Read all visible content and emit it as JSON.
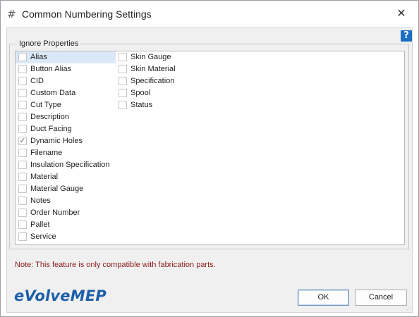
{
  "window": {
    "icon": "hash-icon",
    "icon_glyph": "#",
    "title": "Common Numbering Settings",
    "close_glyph": "✕"
  },
  "help": {
    "glyph": "?",
    "color": "#1c6fc0"
  },
  "ignore_properties": {
    "caption": "Ignore Properties",
    "column1": [
      {
        "label": "Alias",
        "checked": false,
        "selected": true
      },
      {
        "label": "Button Alias",
        "checked": false
      },
      {
        "label": "CID",
        "checked": false
      },
      {
        "label": "Custom Data",
        "checked": false
      },
      {
        "label": "Cut Type",
        "checked": false
      },
      {
        "label": "Description",
        "checked": false
      },
      {
        "label": "Duct Facing",
        "checked": false
      },
      {
        "label": "Dynamic Holes",
        "checked": true
      },
      {
        "label": "Filename",
        "checked": false
      },
      {
        "label": "Insulation Specification",
        "checked": false
      },
      {
        "label": "Material",
        "checked": false
      },
      {
        "label": "Material Gauge",
        "checked": false
      },
      {
        "label": "Notes",
        "checked": false
      },
      {
        "label": "Order Number",
        "checked": false
      },
      {
        "label": "Pallet",
        "checked": false
      },
      {
        "label": "Service",
        "checked": false
      }
    ],
    "column2": [
      {
        "label": "Skin Gauge",
        "checked": false
      },
      {
        "label": "Skin Material",
        "checked": false
      },
      {
        "label": "Specification",
        "checked": false
      },
      {
        "label": "Spool",
        "checked": false
      },
      {
        "label": "Status",
        "checked": false
      }
    ]
  },
  "note": "Note: This feature is only compatible with fabrication parts.",
  "logo": {
    "text": "eVolveMEP",
    "color": "#1d5fa8"
  },
  "buttons": {
    "ok": "OK",
    "cancel": "Cancel"
  },
  "colors": {
    "note": "#8b1a1a",
    "selection": "#dbe8f7"
  }
}
